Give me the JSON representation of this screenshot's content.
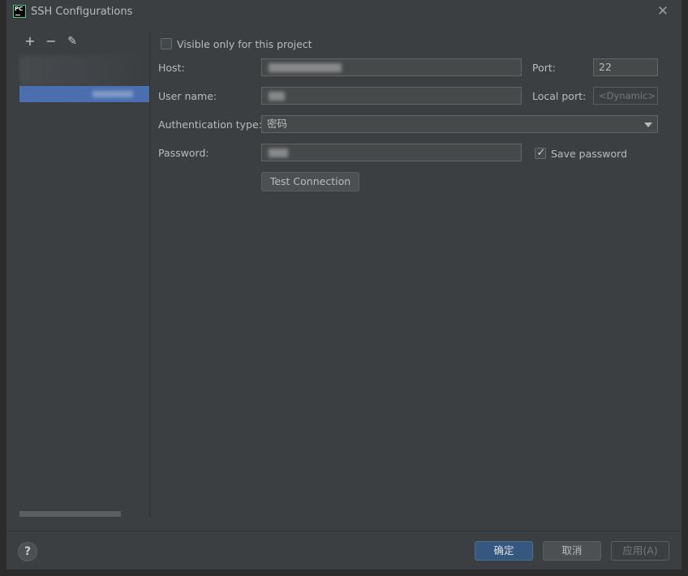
{
  "window": {
    "title": "SSH Configurations",
    "app_icon_text": "PC",
    "close_glyph": "✕"
  },
  "toolbar": {
    "add_glyph": "+",
    "remove_glyph": "−",
    "edit_glyph": "✎"
  },
  "form": {
    "visible_only_label": "Visible only for this project",
    "visible_only_checked": false,
    "host_label": "Host:",
    "host_value": "",
    "port_label": "Port:",
    "port_value": "22",
    "user_label": "User name:",
    "user_value": "",
    "local_port_label": "Local port:",
    "local_port_placeholder": "<Dynamic>",
    "auth_label": "Authentication type:",
    "auth_value": "密码",
    "password_label": "Password:",
    "password_value": "",
    "save_password_label": "Save password",
    "save_password_checked": true,
    "save_password_tick": "✓",
    "test_connection_label": "Test Connection"
  },
  "footer": {
    "help_glyph": "?",
    "ok_label": "确定",
    "cancel_label": "取消",
    "apply_label": "应用(A)"
  },
  "colors": {
    "background": "#3c3f41",
    "selection": "#4b6eaf",
    "primary_button": "#365880",
    "field_bg": "#45494a"
  }
}
